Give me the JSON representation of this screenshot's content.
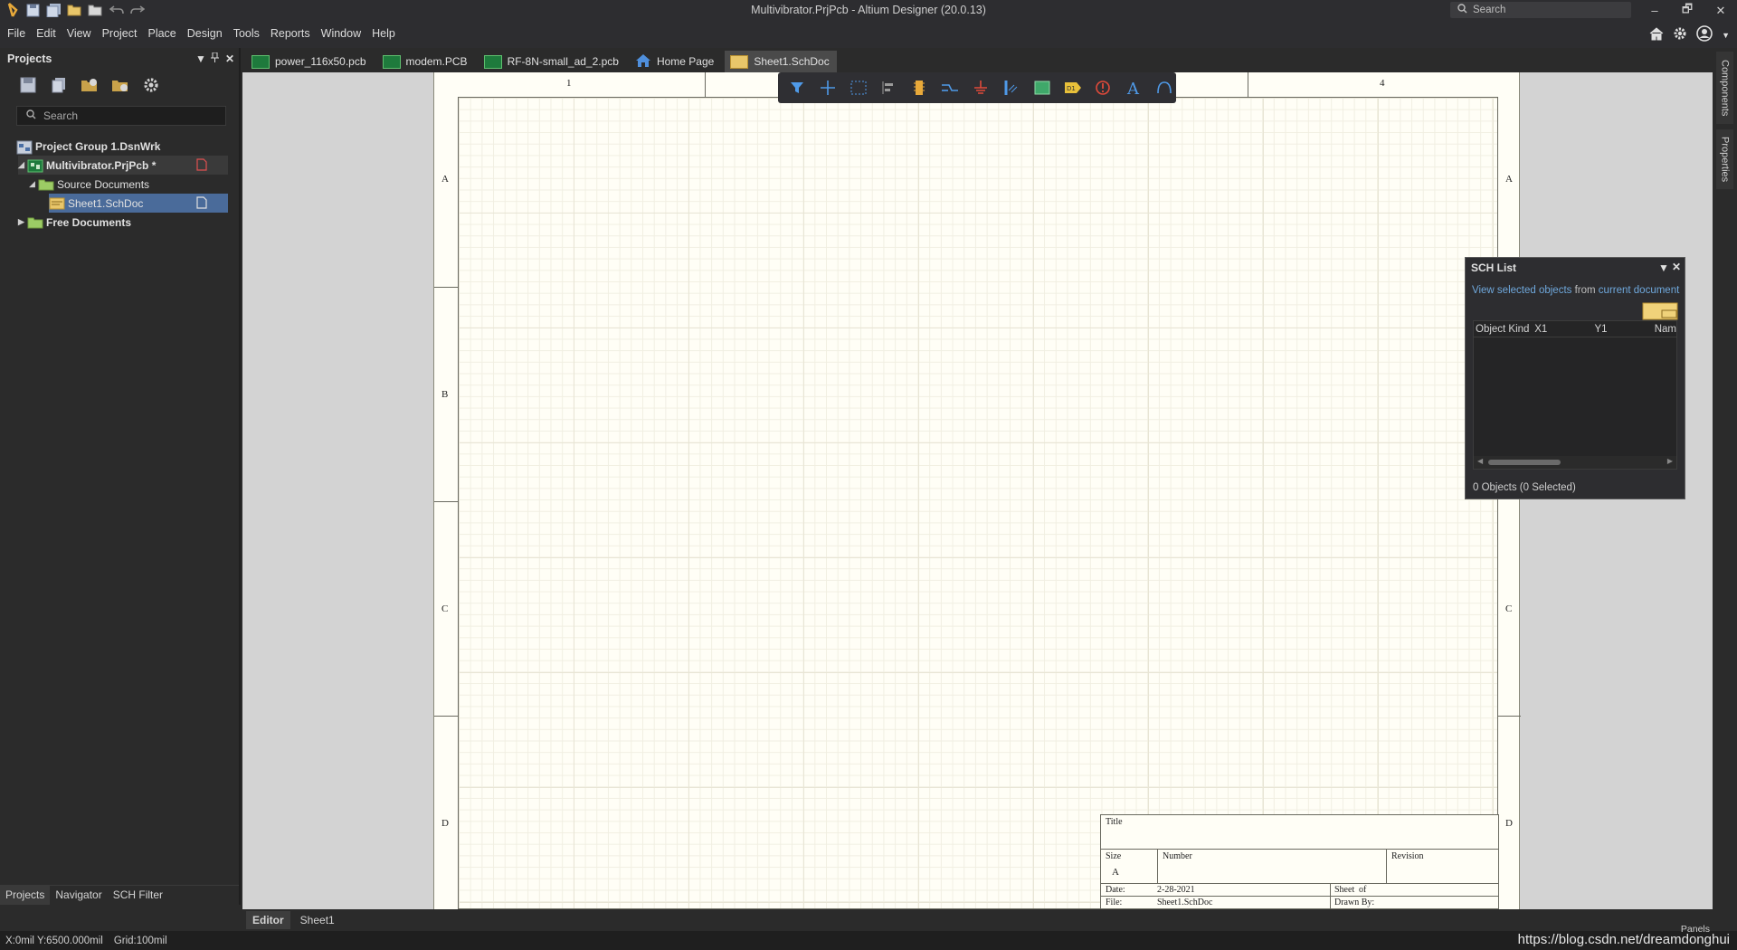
{
  "window": {
    "title": "Multivibrator.PrjPcb - Altium Designer (20.0.13)",
    "search_placeholder": "Search",
    "controls": [
      "–",
      "🗗",
      "✕"
    ]
  },
  "menu": [
    "File",
    "Edit",
    "View",
    "Project",
    "Place",
    "Design",
    "Tools",
    "Reports",
    "Window",
    "Help"
  ],
  "projects_panel": {
    "title": "Projects",
    "search_placeholder": "Search",
    "tree": {
      "group": "Project Group 1.DsnWrk",
      "project": "Multivibrator.PrjPcb *",
      "source_docs": "Source Documents",
      "sheet": "Sheet1.SchDoc",
      "free_docs": "Free Documents"
    },
    "bottom_tabs": [
      "Projects",
      "Navigator",
      "SCH Filter"
    ]
  },
  "doc_tabs": [
    {
      "label": "power_116x50.pcb",
      "icon": "pcb-icon"
    },
    {
      "label": "modem.PCB",
      "icon": "pcb-icon"
    },
    {
      "label": "RF-8N-small_ad_2.pcb",
      "icon": "pcb-icon"
    },
    {
      "label": "Home Page",
      "icon": "home-icon"
    },
    {
      "label": "Sheet1.SchDoc",
      "icon": "schdoc-icon",
      "active": true
    }
  ],
  "sheet": {
    "col_labels": [
      "1",
      "4"
    ],
    "row_labels": [
      "A",
      "B",
      "C",
      "D"
    ],
    "title_block": {
      "title_label": "Title",
      "size_label": "Size",
      "size_value": "A",
      "number_label": "Number",
      "revision_label": "Revision",
      "date_label": "Date:",
      "date_value": "2-28-2021",
      "sheet_label": "Sheet",
      "of_label": "of",
      "file_label": "File:",
      "file_value": "Sheet1.SchDoc",
      "drawn_label": "Drawn By:"
    }
  },
  "sch_list": {
    "title": "SCH List",
    "view_text": "View",
    "selected_objects": "selected objects",
    "from_text": "from",
    "current_document": "current document",
    "columns": [
      "Object Kind",
      "X1",
      "Y1",
      "Nam"
    ],
    "footer": "0 Objects (0 Selected)"
  },
  "right_dock": [
    "Components",
    "Properties"
  ],
  "editor_tabs": [
    "Editor",
    "Sheet1"
  ],
  "status": {
    "coords": "X:0mil Y:6500.000mil",
    "grid": "Grid:100mil",
    "panels": "Panels",
    "watermark": "https://blog.csdn.net/dreamdonghui"
  },
  "colors": {
    "sheet_bg": "#fffef6",
    "editor_bg": "#d3d3d3",
    "accent_selection": "#4a6b9a",
    "link": "#6fa8dc"
  }
}
